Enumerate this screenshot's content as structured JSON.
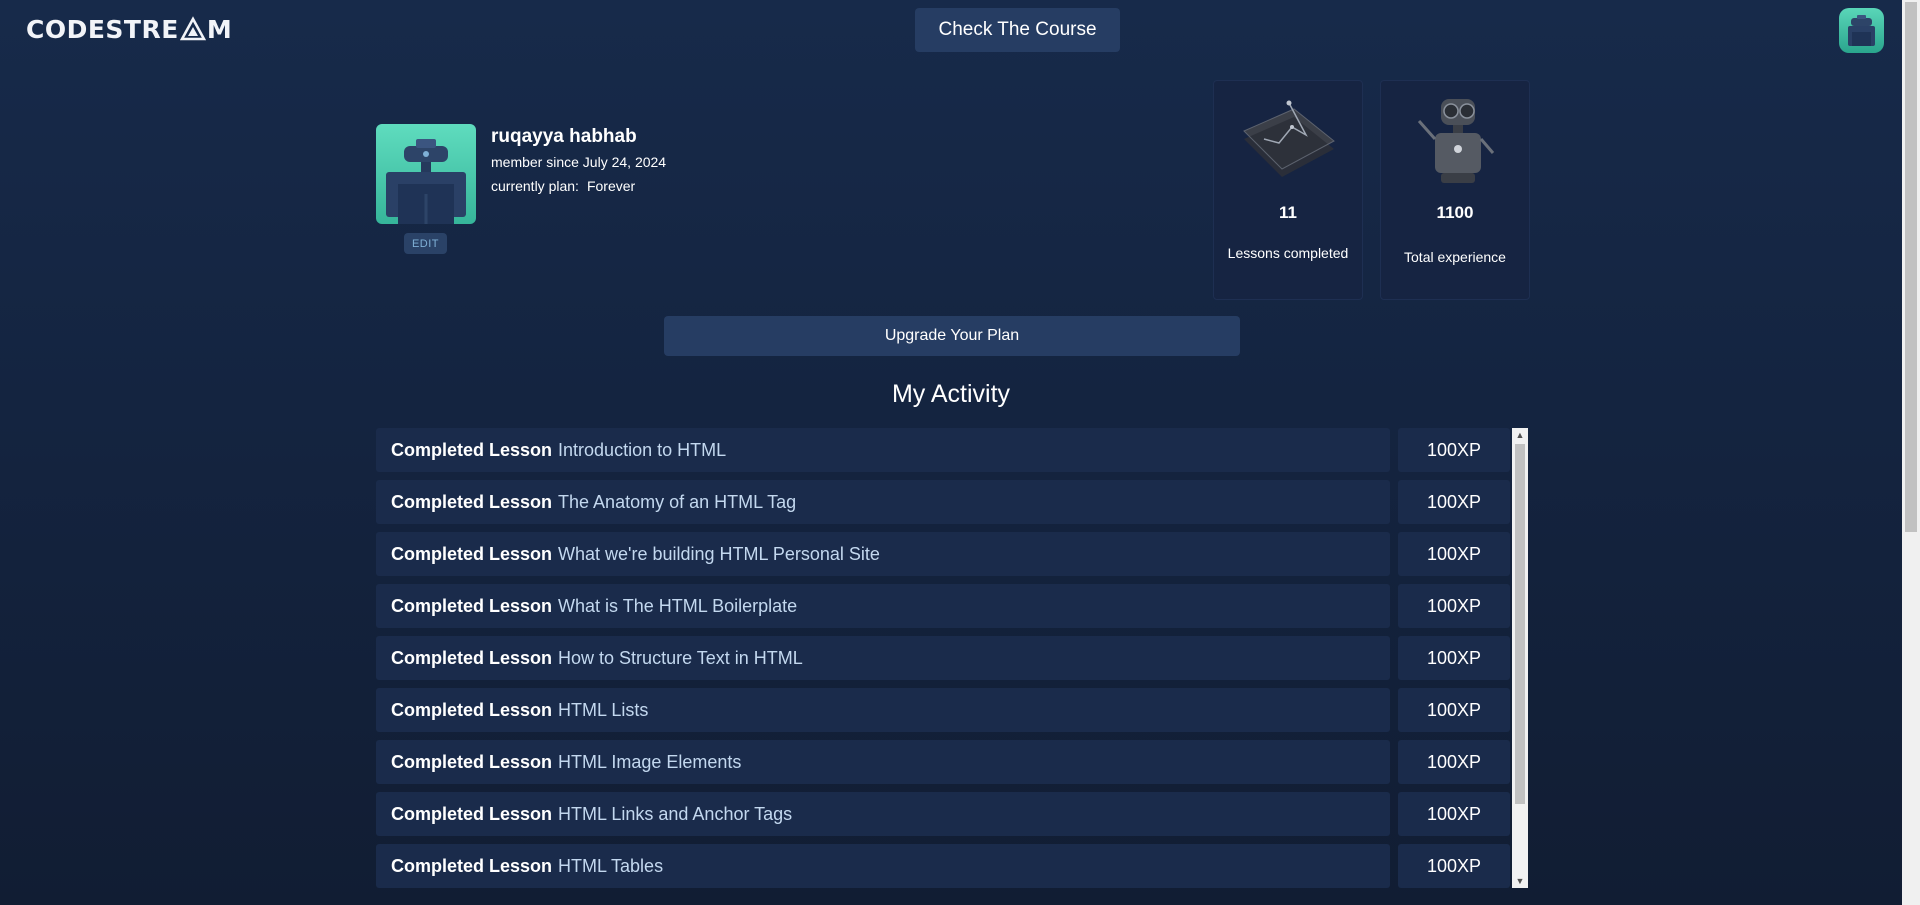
{
  "header": {
    "logo_text": "CODESTREAM",
    "course_button": "Check The Course"
  },
  "profile": {
    "name": "ruqayya habhab",
    "member_since": "member since July 24, 2024",
    "plan_label": "currently plan:",
    "plan_value": "Forever",
    "edit_label": "EDIT"
  },
  "stats": [
    {
      "value": "11",
      "label": "Lessons completed",
      "icon": "tablet-chart-icon"
    },
    {
      "value": "1100",
      "label": "Total experience",
      "icon": "robot-icon"
    }
  ],
  "upgrade_button": "Upgrade Your Plan",
  "activity": {
    "title": "My Activity",
    "prefix": "Completed Lesson",
    "items": [
      {
        "lesson": "Introduction to HTML",
        "xp": "100XP"
      },
      {
        "lesson": "The Anatomy of an HTML Tag",
        "xp": "100XP"
      },
      {
        "lesson": "What we're building HTML Personal Site",
        "xp": "100XP"
      },
      {
        "lesson": "What is The HTML Boilerplate",
        "xp": "100XP"
      },
      {
        "lesson": "How to Structure Text in HTML",
        "xp": "100XP"
      },
      {
        "lesson": "HTML Lists",
        "xp": "100XP"
      },
      {
        "lesson": "HTML Image Elements",
        "xp": "100XP"
      },
      {
        "lesson": "HTML Links and Anchor Tags",
        "xp": "100XP"
      },
      {
        "lesson": "HTML Tables",
        "xp": "100XP"
      }
    ]
  },
  "colors": {
    "background": "#142440",
    "card": "#1a2b4b",
    "button": "#263d63",
    "accent_teal": "#4fcfb2",
    "lesson_text": "#c3d8ef"
  }
}
